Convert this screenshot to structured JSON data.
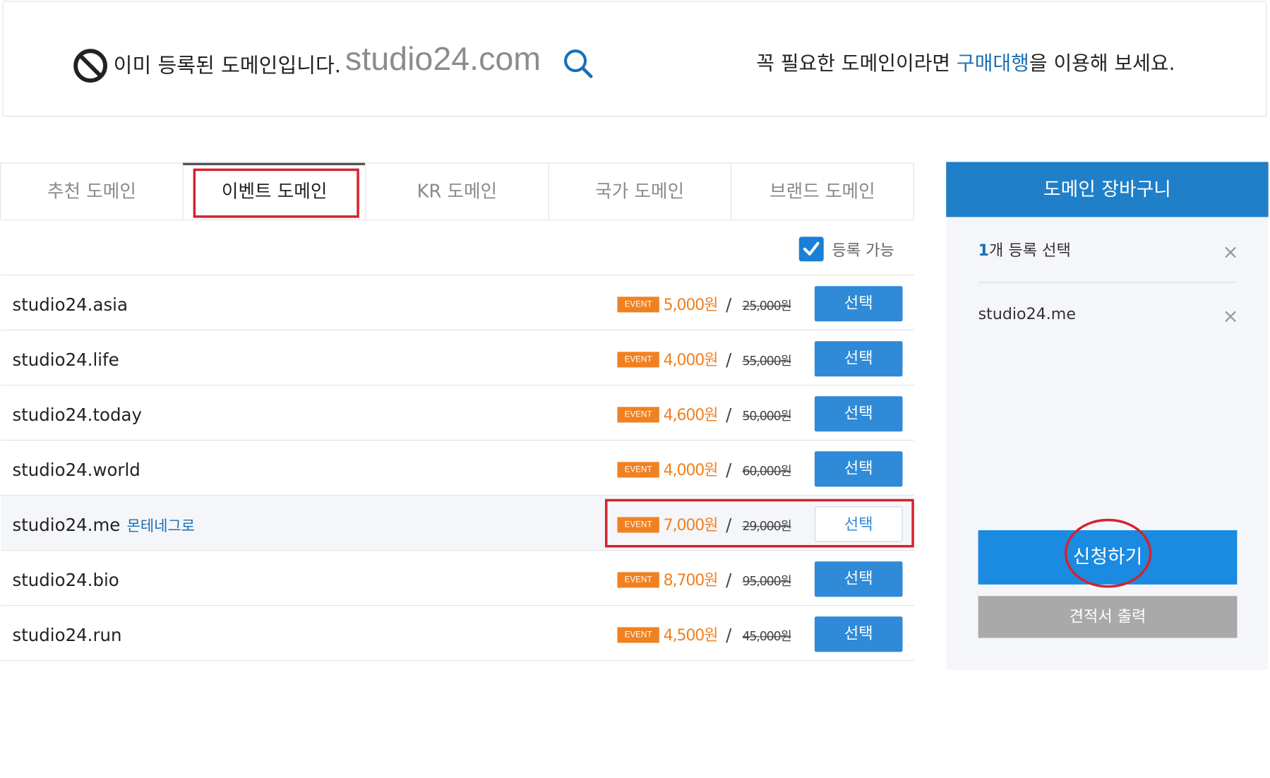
{
  "banner": {
    "message": "이미 등록된 도메인입니다.",
    "domain": "studio24.com",
    "right_pre": "꼭 필요한 도메인이라면 ",
    "right_link": "구매대행",
    "right_post": "을 이용해 보세요."
  },
  "tabs": [
    {
      "label": "추천 도메인",
      "active": false
    },
    {
      "label": "이벤트 도메인",
      "active": true
    },
    {
      "label": "KR 도메인",
      "active": false
    },
    {
      "label": "국가 도메인",
      "active": false
    },
    {
      "label": "브랜드 도메인",
      "active": false
    }
  ],
  "filter": {
    "label": "등록 가능",
    "checked": true
  },
  "rows": [
    {
      "domain": "studio24.asia",
      "country": "",
      "badge": "EVENT",
      "price": "5,000원",
      "slash": "/",
      "original": "25,000원",
      "button": "선택",
      "selected": false
    },
    {
      "domain": "studio24.life",
      "country": "",
      "badge": "EVENT",
      "price": "4,000원",
      "slash": "/",
      "original": "55,000원",
      "button": "선택",
      "selected": false
    },
    {
      "domain": "studio24.today",
      "country": "",
      "badge": "EVENT",
      "price": "4,600원",
      "slash": "/",
      "original": "50,000원",
      "button": "선택",
      "selected": false
    },
    {
      "domain": "studio24.world",
      "country": "",
      "badge": "EVENT",
      "price": "4,000원",
      "slash": "/",
      "original": "60,000원",
      "button": "선택",
      "selected": false
    },
    {
      "domain": "studio24.me",
      "country": "몬테네그로",
      "badge": "EVENT",
      "price": "7,000원",
      "slash": "/",
      "original": "29,000원",
      "button": "선택",
      "selected": true
    },
    {
      "domain": "studio24.bio",
      "country": "",
      "badge": "EVENT",
      "price": "8,700원",
      "slash": "/",
      "original": "95,000원",
      "button": "선택",
      "selected": false
    },
    {
      "domain": "studio24.run",
      "country": "",
      "badge": "EVENT",
      "price": "4,500원",
      "slash": "/",
      "original": "45,000원",
      "button": "선택",
      "selected": false
    }
  ],
  "cart": {
    "title": "도메인 장바구니",
    "count_num": "1",
    "count_text": "개 등록 선택",
    "items": [
      "studio24.me"
    ],
    "apply_label": "신청하기",
    "quote_label": "견적서 출력"
  },
  "colors": {
    "accent": "#1f7fc8",
    "button": "#2f8ad7",
    "event": "#f08122",
    "highlight": "#d3232f"
  },
  "icons": {
    "banner_status": "prohibited-icon",
    "search": "search-icon",
    "checkbox": "check-icon",
    "remove": "close-icon"
  }
}
